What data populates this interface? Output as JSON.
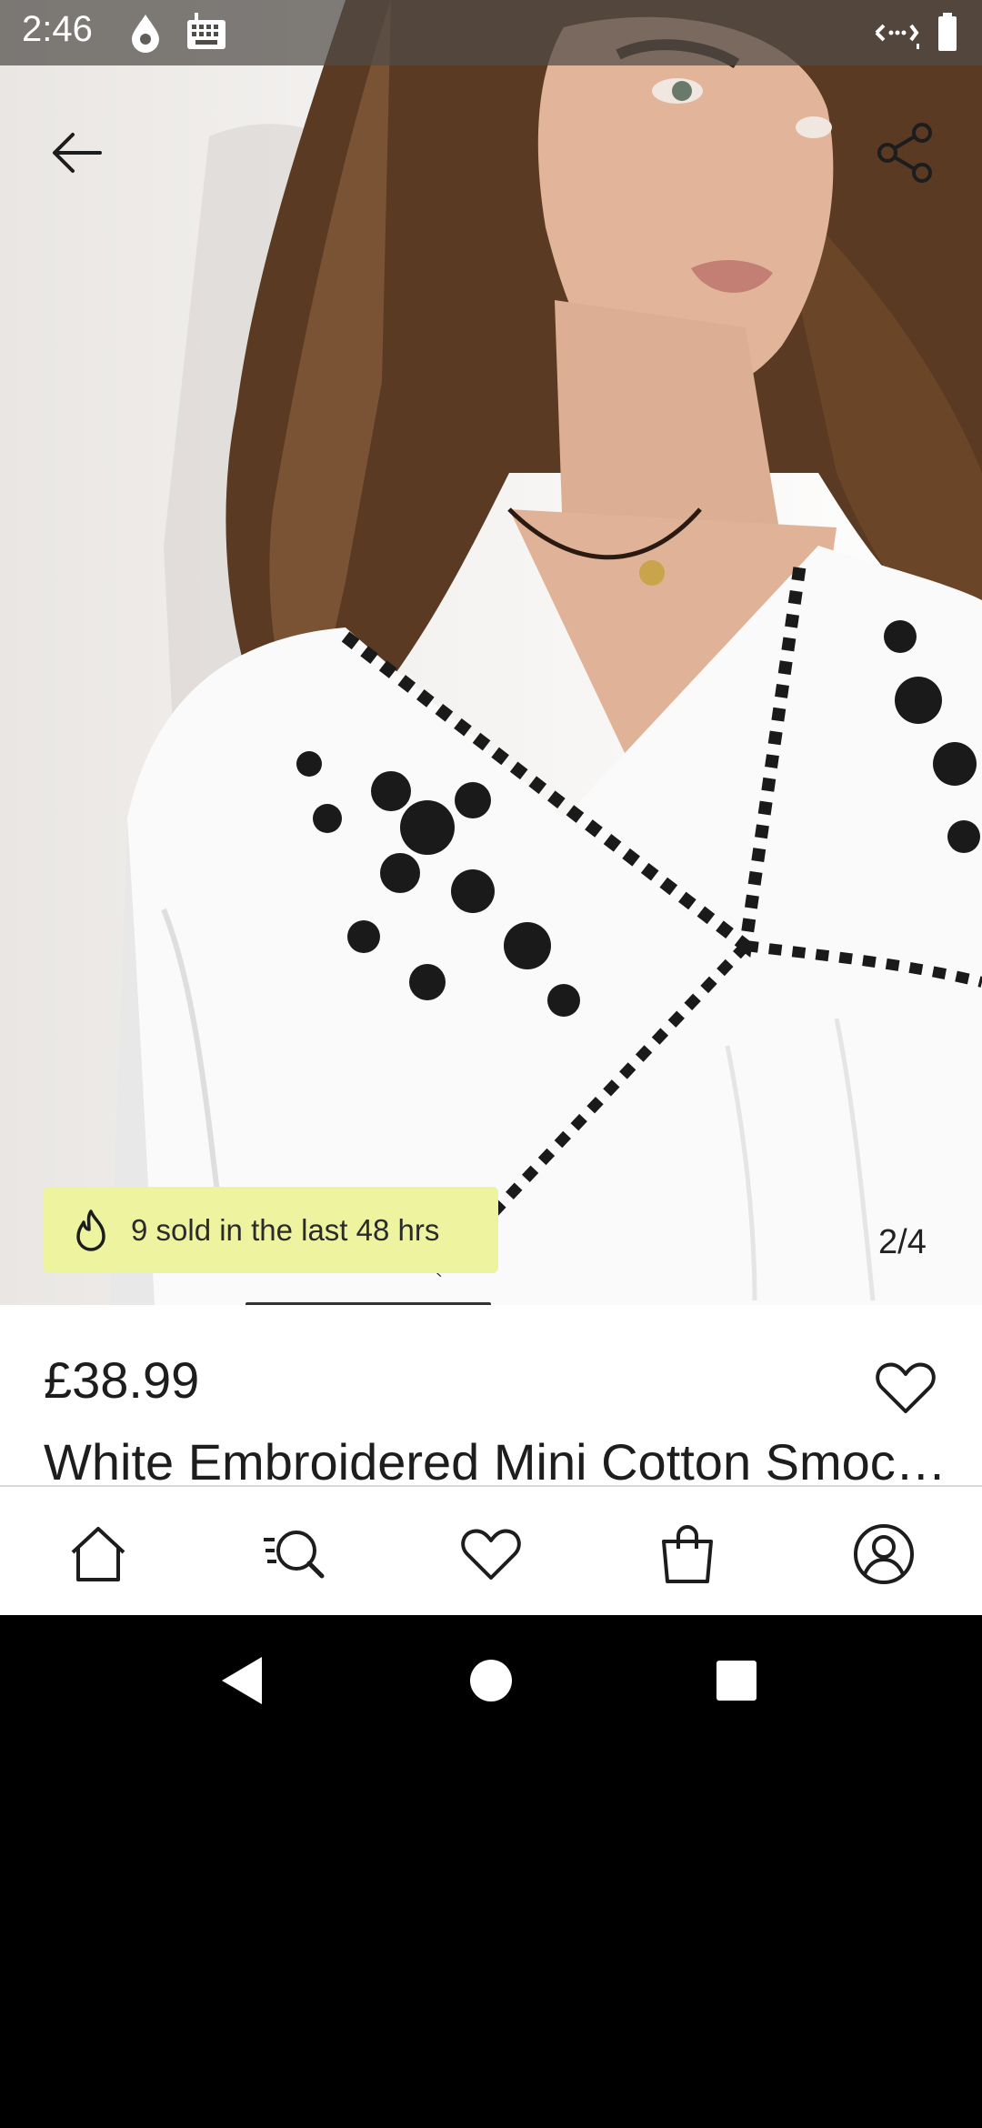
{
  "status_bar": {
    "time": "2:46",
    "icons": [
      "water-drop-icon",
      "keyboard-icon",
      "data-transfer-icon",
      "battery-icon"
    ]
  },
  "toolbar": {
    "back_icon": "arrow-left-icon",
    "share_icon": "share-icon"
  },
  "gallery": {
    "sold_badge": "9 sold in the last 48 hrs",
    "sold_badge_icon": "flame-icon",
    "counter": "2/4",
    "current_image": 2,
    "total_images": 4
  },
  "product": {
    "price": "£38.99",
    "title": "White Embroidered Mini Cotton Smock Dress",
    "wishlist_icon": "heart-icon"
  },
  "bottom_nav": {
    "items": [
      {
        "icon": "home-icon"
      },
      {
        "icon": "search-icon"
      },
      {
        "icon": "heart-icon"
      },
      {
        "icon": "shopping-bag-icon"
      },
      {
        "icon": "account-icon"
      }
    ]
  },
  "system_nav": {
    "buttons": [
      "back-triangle-icon",
      "home-circle-icon",
      "recents-square-icon"
    ]
  },
  "colors": {
    "badge_bg": "#eef3a0",
    "text_primary": "#1d1d1d"
  }
}
